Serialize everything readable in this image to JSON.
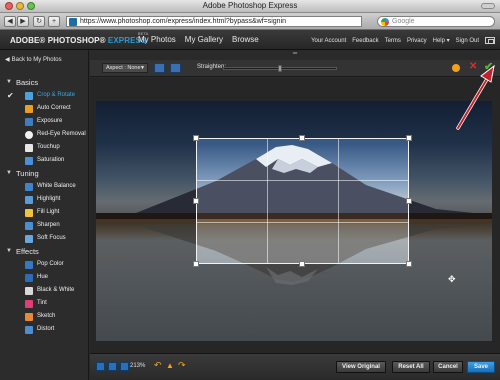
{
  "window": {
    "title": "Adobe Photoshop Express"
  },
  "browser": {
    "back_icon": "back-arrow-icon",
    "forward_icon": "forward-arrow-icon",
    "url": "https://www.photoshop.com/express/index.html?bypass&wf=signin",
    "search_placeholder": "Google"
  },
  "header": {
    "logo_main": "ADOBE® PHOTOSHOP®",
    "logo_express": "EXPRESS",
    "logo_beta": "BETA",
    "nav": [
      "My Photos",
      "My Gallery",
      "Browse"
    ],
    "util": [
      "Your Account",
      "Feedback",
      "Terms",
      "Privacy",
      "Help ▾",
      "Sign Out"
    ]
  },
  "sidebar": {
    "back_label": "Back to My Photos",
    "sections": [
      {
        "name": "Basics",
        "items": [
          {
            "label": "Crop & Rotate",
            "icon": "crop-icon",
            "active": true,
            "checked": true
          },
          {
            "label": "Auto Correct",
            "icon": "auto-correct-icon"
          },
          {
            "label": "Exposure",
            "icon": "exposure-icon"
          },
          {
            "label": "Red-Eye Removal",
            "icon": "red-eye-icon"
          },
          {
            "label": "Touchup",
            "icon": "touchup-icon"
          },
          {
            "label": "Saturation",
            "icon": "saturation-icon"
          }
        ]
      },
      {
        "name": "Tuning",
        "items": [
          {
            "label": "White Balance",
            "icon": "white-balance-icon"
          },
          {
            "label": "Highlight",
            "icon": "highlight-icon"
          },
          {
            "label": "Fill Light",
            "icon": "fill-light-icon"
          },
          {
            "label": "Sharpen",
            "icon": "sharpen-icon"
          },
          {
            "label": "Soft Focus",
            "icon": "soft-focus-icon"
          }
        ]
      },
      {
        "name": "Effects",
        "items": [
          {
            "label": "Pop Color",
            "icon": "pop-color-icon"
          },
          {
            "label": "Hue",
            "icon": "hue-icon"
          },
          {
            "label": "Black & White",
            "icon": "black-white-icon"
          },
          {
            "label": "Tint",
            "icon": "tint-icon"
          },
          {
            "label": "Sketch",
            "icon": "sketch-icon"
          },
          {
            "label": "Distort",
            "icon": "distort-icon"
          }
        ]
      }
    ]
  },
  "editor": {
    "aspect_label": "Aspect : None",
    "straighten_label": "Straighten:",
    "straighten_value": 0.5,
    "zoom": "213%"
  },
  "footer": {
    "view_original": "View Original",
    "reset_all": "Reset All",
    "cancel": "Cancel",
    "save": "Save"
  },
  "colors": {
    "accent": "#36a9e1",
    "save": "#1f7fc8",
    "confirm": "#5bb135",
    "cancel": "#d2312e",
    "annotation": "#c0232b"
  }
}
